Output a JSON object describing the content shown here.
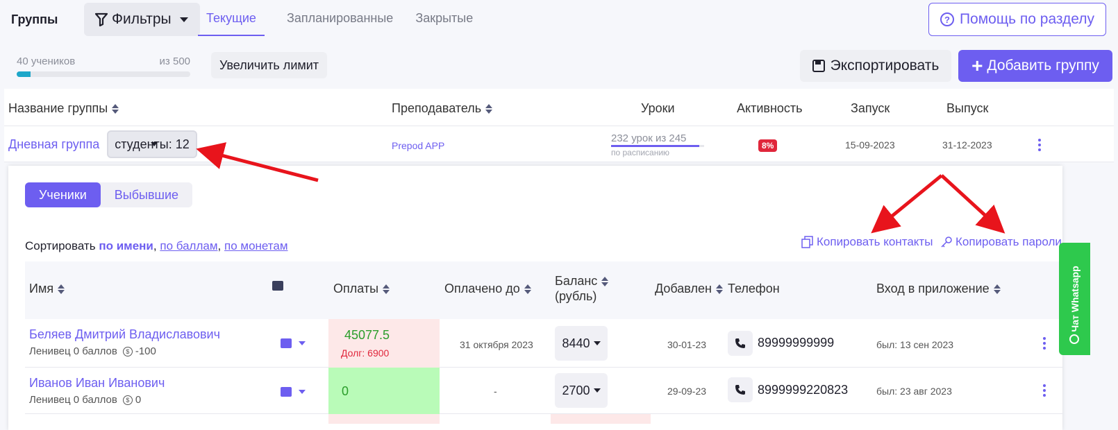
{
  "topbar": {
    "brand": "Группы",
    "filters_label": "Фильтры",
    "tabs": [
      {
        "label": "Текущие",
        "active": true
      },
      {
        "label": "Запланированные",
        "active": false
      },
      {
        "label": "Закрытые",
        "active": false
      }
    ],
    "help_label": "Помощь по разделу"
  },
  "limit": {
    "students": "40 учеников",
    "total": "из 500",
    "progress_fraction": 0.08,
    "increase_label": "Увеличить лимит"
  },
  "actions": {
    "export_label": "Экспортировать",
    "add_label": "Добавить группу"
  },
  "groups_table": {
    "headers": {
      "name": "Название группы",
      "teacher": "Преподаватель",
      "lessons": "Уроки",
      "activity": "Активность",
      "start": "Запуск",
      "end": "Выпуск"
    },
    "row": {
      "name": "Дневная группа",
      "students": "студенты: 12",
      "teacher": "Prepod APP",
      "lessons": "232 урок из 245",
      "lessons_fraction": 0.947,
      "schedule": "по расписанию",
      "activity": "8%",
      "start": "15-09-2023",
      "end": "31-12-2023"
    }
  },
  "panel": {
    "seg_students": "Ученики",
    "seg_dropped": "Выбывшие",
    "sort_prefix": "Сортировать",
    "sort_name": "по имени",
    "sort_points": "по баллам",
    "sort_coins": "по монетам",
    "sep": ",",
    "copy_contacts": "Копировать контакты",
    "copy_passwords": "Копировать пароли"
  },
  "students_table": {
    "headers": {
      "name": "Имя",
      "payments": "Оплаты",
      "paid_to": "Оплачено до",
      "balance_1": "Баланс",
      "balance_2": "(рубль)",
      "added": "Добавлен",
      "phone": "Телефон",
      "login": "Вход в приложение"
    },
    "rows": [
      {
        "name": "Беляев Дмитрий Владиславович",
        "sub": "Ленивец 0 баллов",
        "coins": "-100",
        "paid": "45077.5",
        "debt": "Долг: 6900",
        "paid_to": "31 октября 2023",
        "balance": "8440",
        "added": "30-01-23",
        "phone": "89999999999",
        "login": "был: 13 сен 2023"
      },
      {
        "name": "Иванов Иван Иванович",
        "sub": "Ленивец 0 баллов",
        "coins": "0",
        "paid": "0",
        "debt": "",
        "paid_to": "-",
        "balance": "2700",
        "added": "29-09-23",
        "phone": "8999999220823",
        "login": "был: 23 авг 2023"
      }
    ]
  },
  "whatsapp_label": "Чат Whatsapp",
  "colors": {
    "accent": "#6d5ef0",
    "danger": "#e0263b",
    "success": "#2a9d2a",
    "whatsapp": "#2ec94d",
    "arrow": "#e8141c"
  }
}
